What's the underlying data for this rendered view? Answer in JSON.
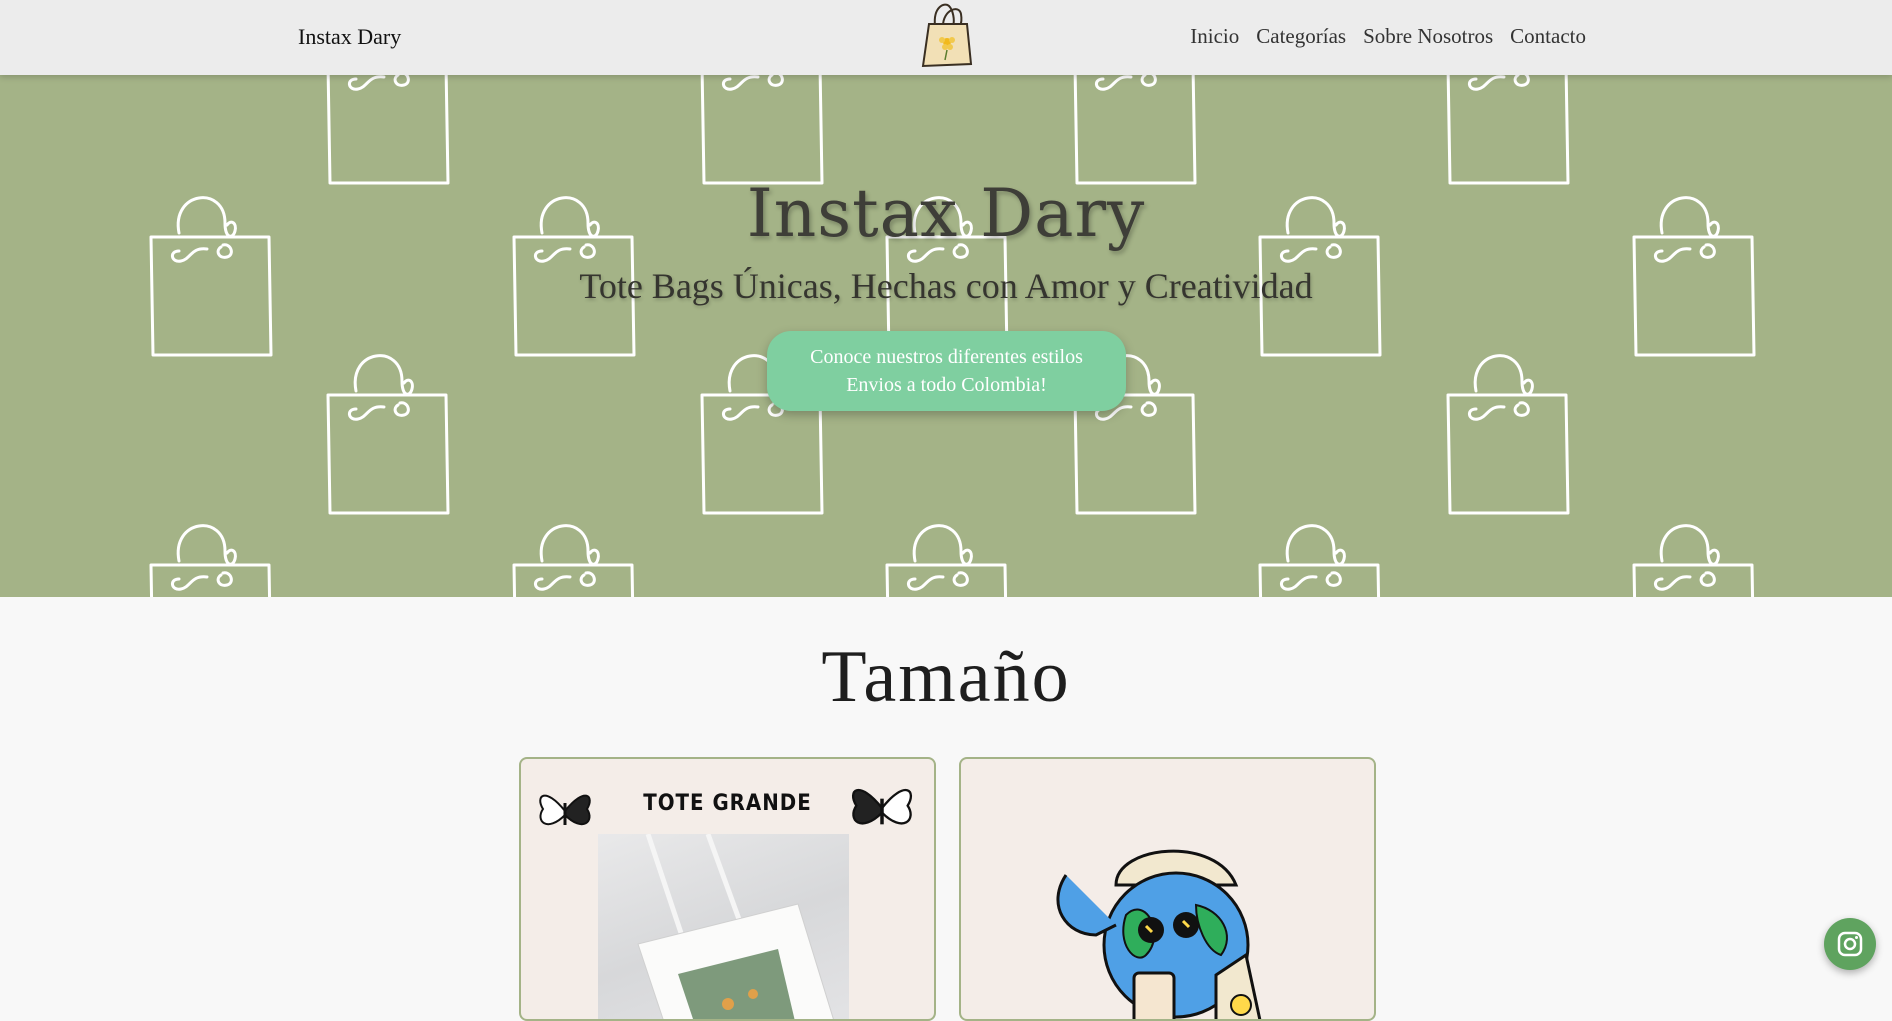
{
  "navbar": {
    "brand": "Instax Dary",
    "logo_icon": "tote-bag-flower-icon",
    "links": [
      "Inicio",
      "Categorías",
      "Sobre Nosotros",
      "Contacto"
    ]
  },
  "hero": {
    "title": "Instax Dary",
    "subtitle": "Tote Bags Únicas, Hechas con Amor y Creatividad",
    "cta_line1": "Conoce nuestros diferentes estilos",
    "cta_line2": "Envios a todo Colombia!",
    "background_color": "#a4b387",
    "pattern_icon": "shopping-bag-outline-icon",
    "cta_color": "#7fcfa0"
  },
  "section": {
    "title": "Tamaño",
    "cards": [
      {
        "label": "TOTE GRANDE",
        "decor_icon": "butterfly-icon"
      },
      {
        "label": "",
        "decor_icon": "earth-mascot-icon"
      }
    ]
  },
  "floating": {
    "icon": "instagram-icon",
    "color": "#5fa35f"
  }
}
